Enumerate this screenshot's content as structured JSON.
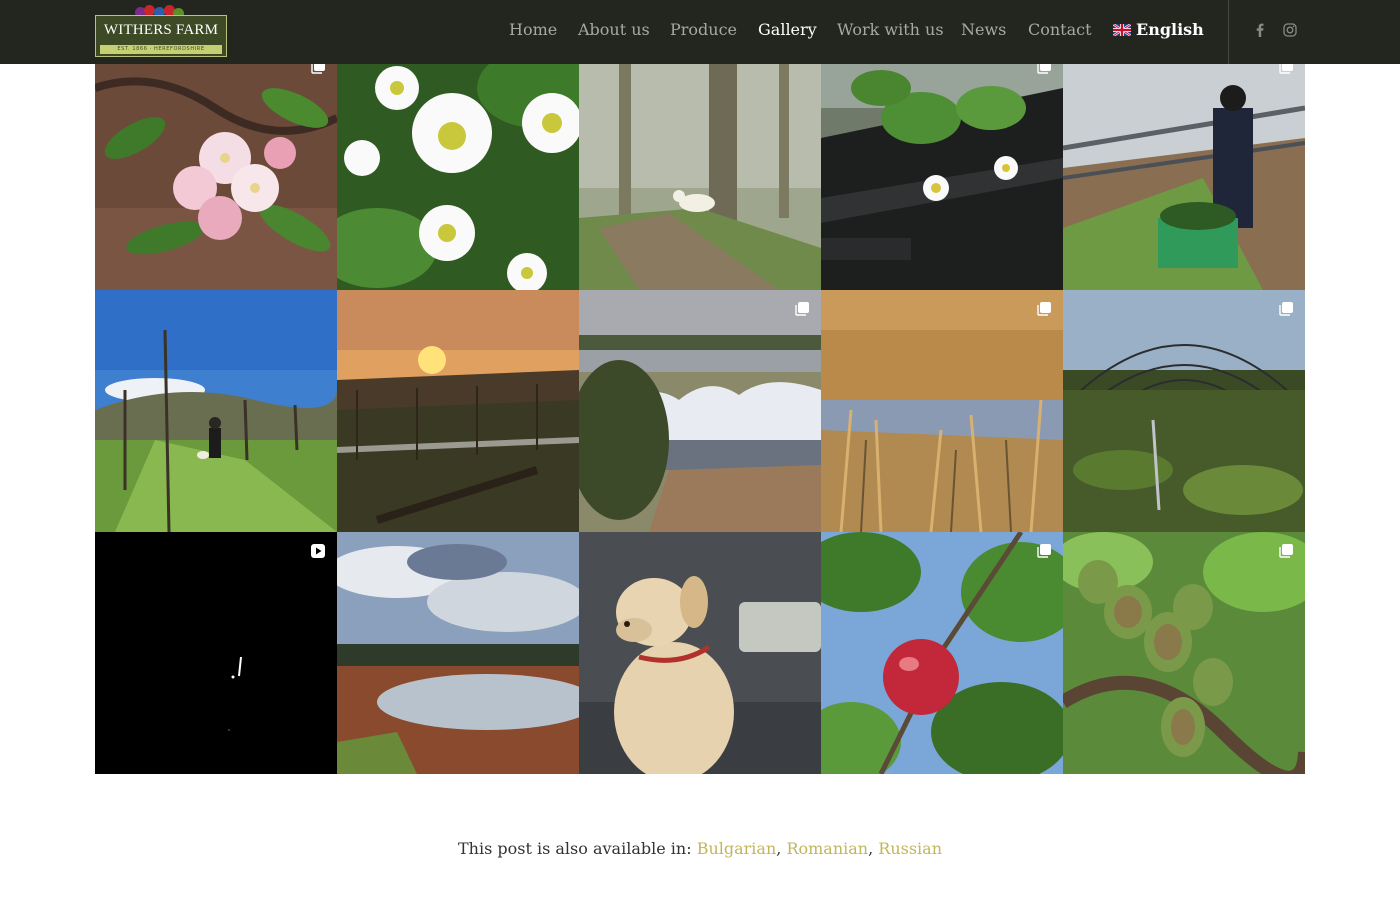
{
  "brand": {
    "name": "WITHERS FARM",
    "tagline": "EST. 1866 · HEREFORDSHIRE"
  },
  "nav": {
    "items": [
      {
        "label": "Home",
        "active": false
      },
      {
        "label": "About us",
        "active": false
      },
      {
        "label": "Produce",
        "active": false
      },
      {
        "label": "Gallery",
        "active": true
      },
      {
        "label": "Work with us",
        "active": false
      },
      {
        "label": "News",
        "active": false
      },
      {
        "label": "Contact",
        "active": false
      }
    ],
    "language": "English",
    "social": [
      "facebook-icon",
      "instagram-icon"
    ]
  },
  "gallery": {
    "tiles": [
      {
        "subject": "apple blossom",
        "badge": "multi-image"
      },
      {
        "subject": "strawberry flowers",
        "badge": "none"
      },
      {
        "subject": "dog on woodland path",
        "badge": "none"
      },
      {
        "subject": "strawberry plant in grow bag",
        "badge": "multi-image"
      },
      {
        "subject": "worker in polytunnel",
        "badge": "multi-image"
      },
      {
        "subject": "person and dog in orchard",
        "badge": "none"
      },
      {
        "subject": "sunset over orchard",
        "badge": "none"
      },
      {
        "subject": "snow covered polytunnels",
        "badge": "multi-image"
      },
      {
        "subject": "reeds by lake",
        "badge": "multi-image"
      },
      {
        "subject": "polytunnel frame at dusk",
        "badge": "multi-image"
      },
      {
        "subject": "video",
        "badge": "video"
      },
      {
        "subject": "reservoir under cloudy sky",
        "badge": "none"
      },
      {
        "subject": "labrador in vehicle",
        "badge": "none"
      },
      {
        "subject": "red apple on tree",
        "badge": "multi-image"
      },
      {
        "subject": "kiwi berries",
        "badge": "multi-image"
      }
    ]
  },
  "footer": {
    "also_available_prefix": "This post is also available in:",
    "languages": [
      "Bulgarian",
      "Romanian",
      "Russian"
    ]
  },
  "colors": {
    "header_bg": "#23251f",
    "link": "#c2b55a",
    "nav_inactive": "#a8a8a0"
  }
}
